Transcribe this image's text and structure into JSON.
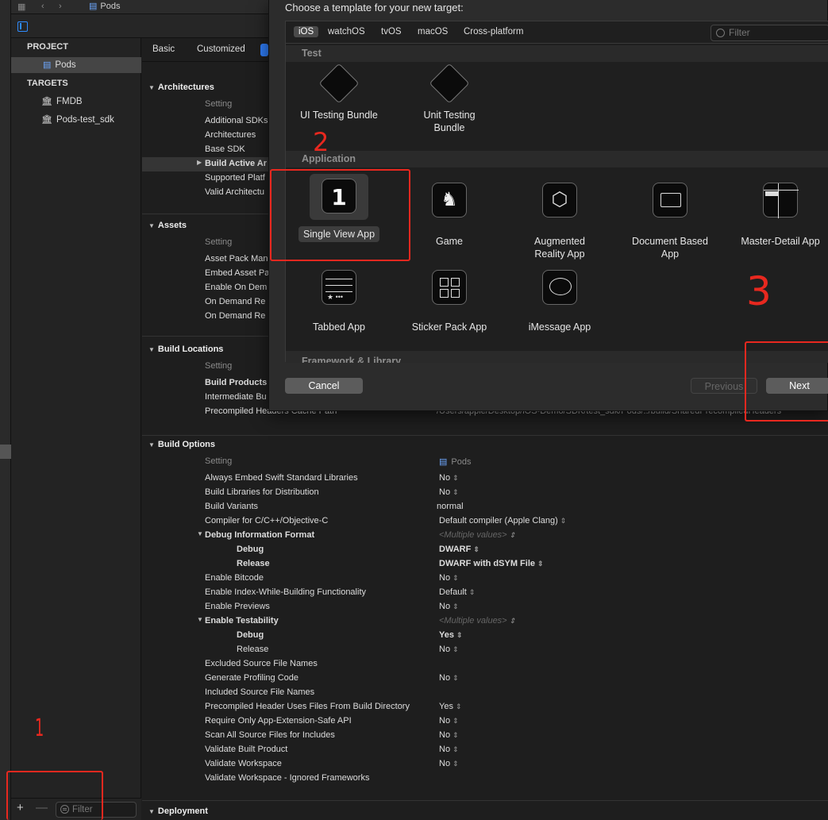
{
  "topbar": {
    "crumb": "Pods"
  },
  "navigator": {
    "project_header": "PROJECT",
    "project_item": "Pods",
    "targets_header": "TARGETS",
    "targets": [
      "FMDB",
      "Pods-test_sdk"
    ],
    "filter_placeholder": "Filter"
  },
  "tabs": {
    "basic": "Basic",
    "customized": "Customized"
  },
  "sections": {
    "architectures": "Architectures",
    "assets": "Assets",
    "build_locations": "Build Locations",
    "build_options": "Build Options",
    "deployment": "Deployment"
  },
  "col_setting": "Setting",
  "col_pods": "Pods",
  "arch_rows": [
    "Additional SDKs",
    "Architectures",
    "Base SDK",
    "Build Active Ar",
    "Supported Platf",
    "Valid Architectu"
  ],
  "asset_rows": [
    "Asset Pack Man",
    "Embed Asset Pa",
    "Enable On Dem",
    "On Demand Re",
    "On Demand Re"
  ],
  "location_rows": [
    "Build Products",
    "Intermediate Bu",
    "Precompiled Headers Cache Path"
  ],
  "location_value": "/Users/apple/Desktop/iOS-Demo/SDK/test_sdk/Pods/../build/SharedPrecompiledHeaders",
  "options": [
    {
      "name": "Always Embed Swift Standard Libraries",
      "value": "No"
    },
    {
      "name": "Build Libraries for Distribution",
      "value": "No"
    },
    {
      "name": "Build Variants",
      "value": "normal"
    },
    {
      "name": "Compiler for C/C++/Objective-C",
      "value": "Default compiler (Apple Clang)"
    },
    {
      "name": "Debug Information Format",
      "value": "<Multiple values>"
    },
    {
      "name": "Debug",
      "value": "DWARF"
    },
    {
      "name": "Release",
      "value": "DWARF with dSYM File"
    },
    {
      "name": "Enable Bitcode",
      "value": "No"
    },
    {
      "name": "Enable Index-While-Building Functionality",
      "value": "Default"
    },
    {
      "name": "Enable Previews",
      "value": "No"
    },
    {
      "name": "Enable Testability",
      "value": "<Multiple values>"
    },
    {
      "name": "Debug",
      "value": "Yes"
    },
    {
      "name": "Release",
      "value": "No"
    },
    {
      "name": "Excluded Source File Names",
      "value": ""
    },
    {
      "name": "Generate Profiling Code",
      "value": "No"
    },
    {
      "name": "Included Source File Names",
      "value": ""
    },
    {
      "name": "Precompiled Header Uses Files From Build Directory",
      "value": "Yes"
    },
    {
      "name": "Require Only App-Extension-Safe API",
      "value": "No"
    },
    {
      "name": "Scan All Source Files for Includes",
      "value": "No"
    },
    {
      "name": "Validate Built Product",
      "value": "No"
    },
    {
      "name": "Validate Workspace",
      "value": "No"
    },
    {
      "name": "Validate Workspace - Ignored Frameworks",
      "value": ""
    }
  ],
  "sheet": {
    "title": "Choose a template for your new target:",
    "platforms": [
      "iOS",
      "watchOS",
      "tvOS",
      "macOS",
      "Cross-platform"
    ],
    "filter_placeholder": "Filter",
    "group_test": "Test",
    "group_application": "Application",
    "group_framework": "Framework & Library",
    "test_templates": [
      "UI Testing Bundle",
      "Unit Testing Bundle"
    ],
    "app_templates": [
      "Single View App",
      "Game",
      "Augmented Reality App",
      "Document Based App",
      "Master-Detail App",
      "Tabbed App",
      "Sticker Pack App",
      "iMessage App"
    ],
    "cancel": "Cancel",
    "previous": "Previous",
    "next": "Next"
  },
  "annotations": {
    "mark1": "1",
    "mark2": "2",
    "mark3": "3"
  },
  "colors": {
    "accent": "#2f7df6",
    "annotation_red": "#e8281f"
  }
}
